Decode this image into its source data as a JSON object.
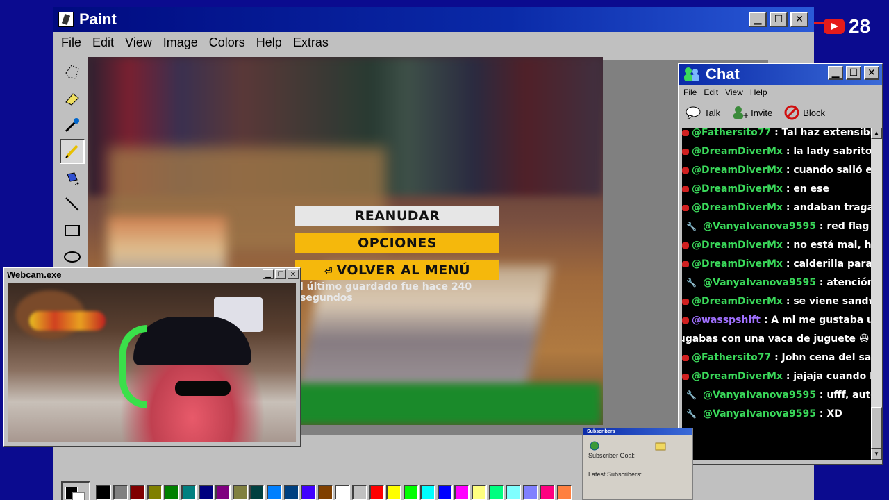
{
  "paint": {
    "title": "Paint",
    "menu": [
      "File",
      "Edit",
      "View",
      "Image",
      "Colors",
      "Help",
      "Extras"
    ],
    "tools": [
      "free-select",
      "rect-select",
      "eraser",
      "fill",
      "color-picker",
      "magnifier",
      "pencil",
      "brush",
      "airbrush",
      "text",
      "line",
      "curve",
      "rectangle",
      "polygon",
      "ellipse",
      "rounded-rectangle"
    ],
    "palette": [
      "#000000",
      "#808080",
      "#800000",
      "#808000",
      "#008000",
      "#008080",
      "#000080",
      "#800080",
      "#808040",
      "#004040",
      "#0080ff",
      "#004080",
      "#4000ff",
      "#804000",
      "#ffffff",
      "#c0c0c0",
      "#ff0000",
      "#ffff00",
      "#00ff00",
      "#00ffff",
      "#0000ff",
      "#ff00ff",
      "#ffff80",
      "#00ff80",
      "#80ffff",
      "#8080ff",
      "#ff0080",
      "#ff8040"
    ]
  },
  "game": {
    "resume": "REANUDAR",
    "options": "OPCIONES",
    "back_to_menu": "VOLVER AL MENÚ",
    "save_note": "l último guardado fue hace 240 segundos"
  },
  "webcam": {
    "title": "Webcam.exe"
  },
  "chat": {
    "title": "Chat",
    "menu": [
      "File",
      "Edit",
      "View",
      "Help"
    ],
    "toolbar": {
      "talk": "Talk",
      "invite": "Invite",
      "block": "Block"
    },
    "messages": [
      {
        "user": "@Fathersito77",
        "text": ": Tal haz extensible",
        "badge": "dot",
        "color": "green"
      },
      {
        "user": "@DreamDiverMx",
        "text": ": la lady sabritones",
        "badge": "dot",
        "color": "green"
      },
      {
        "user": "@DreamDiverMx",
        "text": ": cuando salió en el video i",
        "badge": "dot",
        "color": "green"
      },
      {
        "user": "@DreamDiverMx",
        "text": ": en ese",
        "badge": "dot",
        "color": "green"
      },
      {
        "user": "@DreamDiverMx",
        "text": ": andaban tragando sabrito",
        "badge": "dot",
        "color": "green"
      },
      {
        "user": "@VanyaIvanova9595",
        "text": ": red flag que coma",
        "badge": "wrench",
        "color": "green"
      },
      {
        "user": "@DreamDiverMx",
        "text": ": no está mal, ha de tener l",
        "badge": "dot",
        "color": "green"
      },
      {
        "user": "@DreamDiverMx",
        "text": ": calderilla para los Judios",
        "badge": "dot",
        "color": "green"
      },
      {
        "user": "@VanyaIvanova9595",
        "text": ": atención shavales",
        "badge": "wrench",
        "color": "green"
      },
      {
        "user": "@DreamDiverMx",
        "text": ": se viene sandwish de bub",
        "badge": "dot",
        "color": "green"
      },
      {
        "user": "@wasspshift",
        "text": ": A mi me gustaba uno donde g",
        "badge": "dot",
        "color": "purple"
      },
      {
        "user": "",
        "text": "jugabas con una vaca de juguete 😆",
        "badge": "none",
        "color": "none"
      },
      {
        "user": "@Fathersito77",
        "text": ": John cena del salseo ☝",
        "badge": "dot",
        "color": "green"
      },
      {
        "user": "@DreamDiverMx",
        "text": ": jajaja cuando hablaste tra",
        "badge": "dot",
        "color": "green"
      },
      {
        "user": "@VanyaIvanova9595",
        "text": ": ufff, auténtico cine",
        "badge": "wrench",
        "color": "green"
      },
      {
        "user": "@VanyaIvanova9595",
        "text": ": XD",
        "badge": "wrench",
        "color": "green"
      }
    ]
  },
  "subscribers": {
    "title": "Subscribers",
    "goal_label": "Subscriber Goal:",
    "latest_label": "Latest Subscribers:"
  },
  "youtube": {
    "count": "28"
  }
}
